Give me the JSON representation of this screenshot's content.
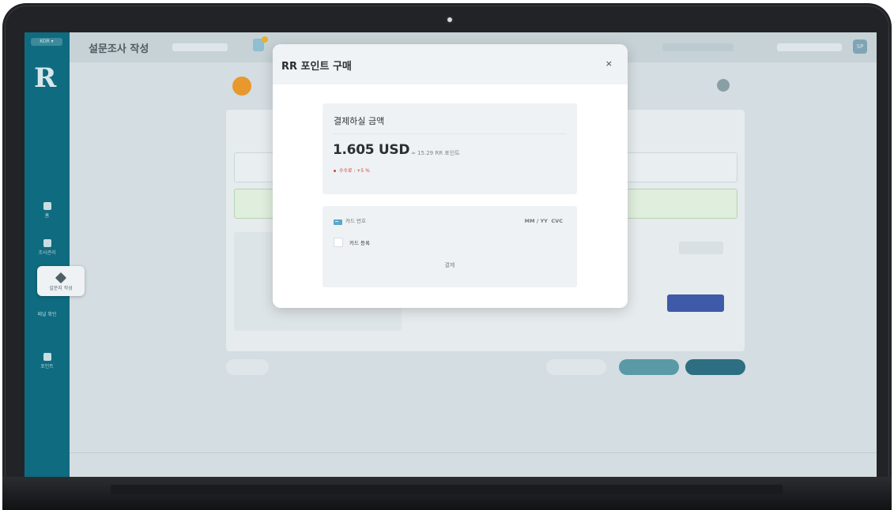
{
  "app": {
    "language": "KOR ▾",
    "logo": "R",
    "title": "설문조사 작성",
    "sidebar": [
      {
        "label": "홈"
      },
      {
        "label": "조사관리"
      },
      {
        "label": "설문지 작성"
      },
      {
        "label": "패널 확인"
      },
      {
        "label": "포인트"
      }
    ],
    "user_initials": "SP"
  },
  "modal": {
    "title": "RR 포인트 구매",
    "close": "×",
    "amount_label": "결제하실 금액",
    "amount_value": "1.605 USD",
    "amount_approx": "≈ 15.29 RR 포인트",
    "fee": "수수료 : +5 %",
    "card_number_placeholder": "카드 번호",
    "card_expiry_placeholder": "MM / YY  CVC",
    "save_card_label": "카드 등록",
    "pay_button": "결제"
  }
}
